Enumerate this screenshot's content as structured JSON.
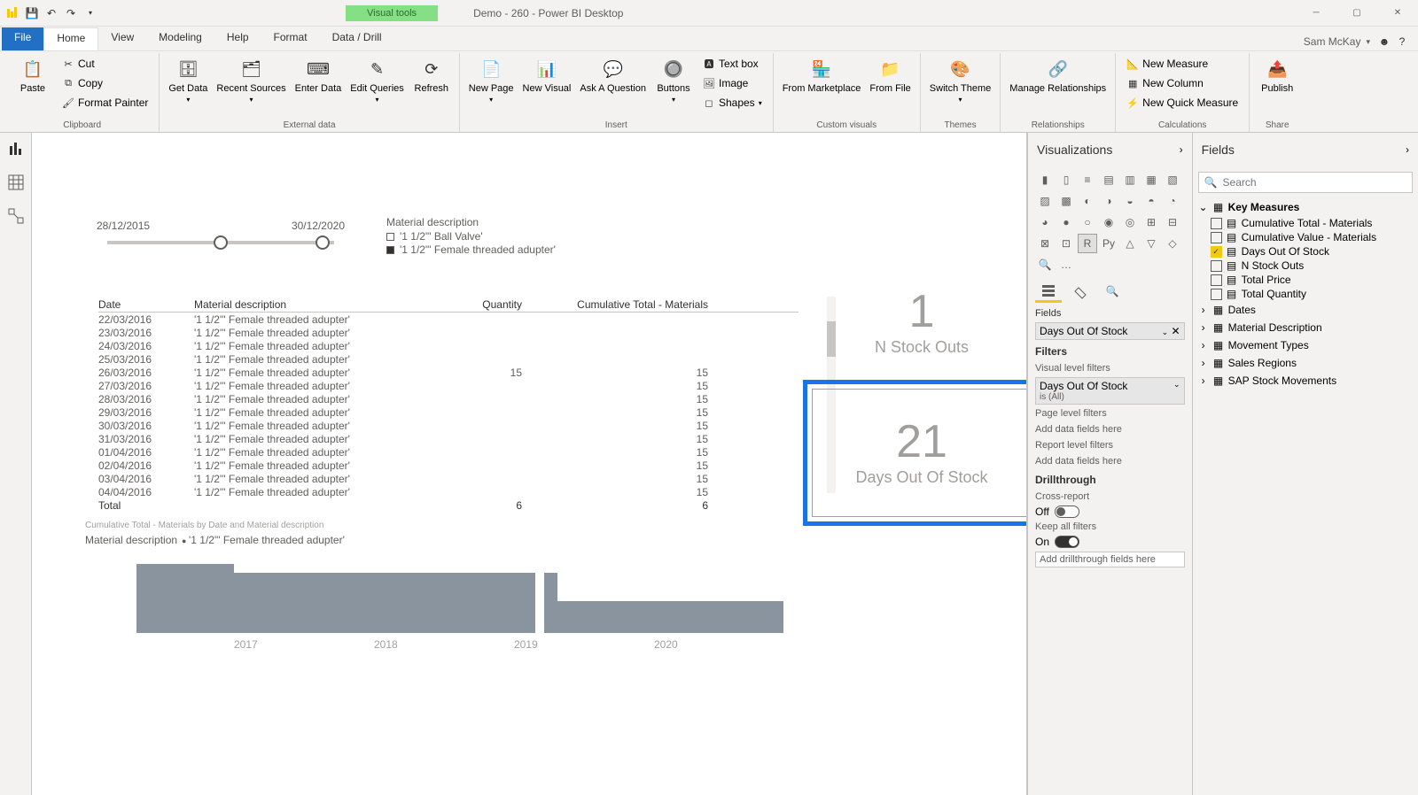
{
  "titlebar": {
    "visual_tools": "Visual tools",
    "doc": "Demo - 260 - Power BI Desktop"
  },
  "account": {
    "name": "Sam McKay"
  },
  "tabs": {
    "file": "File",
    "home": "Home",
    "view": "View",
    "modeling": "Modeling",
    "help": "Help",
    "format": "Format",
    "datadrill": "Data / Drill"
  },
  "ribbon": {
    "clipboard": {
      "label": "Clipboard",
      "paste": "Paste",
      "cut": "Cut",
      "copy": "Copy",
      "fmt": "Format Painter"
    },
    "external": {
      "label": "External data",
      "get": "Get Data",
      "recent": "Recent Sources",
      "enter": "Enter Data",
      "edit": "Edit Queries",
      "refresh": "Refresh"
    },
    "insert": {
      "label": "Insert",
      "newpage": "New Page",
      "newvis": "New Visual",
      "ask": "Ask A Question",
      "buttons": "Buttons",
      "textbox": "Text box",
      "image": "Image",
      "shapes": "Shapes"
    },
    "custom": {
      "label": "Custom visuals",
      "market": "From Marketplace",
      "file": "From File"
    },
    "themes": {
      "label": "Themes",
      "switch": "Switch Theme"
    },
    "rel": {
      "label": "Relationships",
      "manage": "Manage Relationships"
    },
    "calc": {
      "label": "Calculations",
      "nm": "New Measure",
      "nc": "New Column",
      "nq": "New Quick Measure"
    },
    "share": {
      "label": "Share",
      "publish": "Publish"
    }
  },
  "canvas": {
    "slicer": {
      "from": "28/12/2015",
      "to": "30/12/2020"
    },
    "legend": {
      "title": "Material description",
      "s1": "'1 1/2\"' Ball Valve'",
      "s2": "'1 1/2\"' Female threaded adupter'"
    },
    "table": {
      "headers": [
        "Date",
        "Material description",
        "Quantity",
        "Cumulative Total - Materials"
      ],
      "rows": [
        [
          "22/03/2016",
          "'1 1/2\"' Female threaded adupter'",
          "",
          ""
        ],
        [
          "23/03/2016",
          "'1 1/2\"' Female threaded adupter'",
          "",
          ""
        ],
        [
          "24/03/2016",
          "'1 1/2\"' Female threaded adupter'",
          "",
          ""
        ],
        [
          "25/03/2016",
          "'1 1/2\"' Female threaded adupter'",
          "",
          ""
        ],
        [
          "26/03/2016",
          "'1 1/2\"' Female threaded adupter'",
          "15",
          "15"
        ],
        [
          "27/03/2016",
          "'1 1/2\"' Female threaded adupter'",
          "",
          "15"
        ],
        [
          "28/03/2016",
          "'1 1/2\"' Female threaded adupter'",
          "",
          "15"
        ],
        [
          "29/03/2016",
          "'1 1/2\"' Female threaded adupter'",
          "",
          "15"
        ],
        [
          "30/03/2016",
          "'1 1/2\"' Female threaded adupter'",
          "",
          "15"
        ],
        [
          "31/03/2016",
          "'1 1/2\"' Female threaded adupter'",
          "",
          "15"
        ],
        [
          "01/04/2016",
          "'1 1/2\"' Female threaded adupter'",
          "",
          "15"
        ],
        [
          "02/04/2016",
          "'1 1/2\"' Female threaded adupter'",
          "",
          "15"
        ],
        [
          "03/04/2016",
          "'1 1/2\"' Female threaded adupter'",
          "",
          "15"
        ],
        [
          "04/04/2016",
          "'1 1/2\"' Female threaded adupter'",
          "",
          "15"
        ]
      ],
      "total": [
        "Total",
        "",
        "6",
        "6"
      ]
    },
    "card1": {
      "value": "1",
      "label": "N Stock Outs"
    },
    "card2": {
      "value": "21",
      "label": "Days Out Of Stock"
    },
    "chart": {
      "title": "Cumulative Total - Materials by Date and Material description",
      "legendlabel": "Material description",
      "series": "'1 1/2\"' Female threaded adupter'"
    }
  },
  "vis": {
    "title": "Visualizations",
    "fields": "Fields",
    "well_field": "Days Out Of Stock",
    "filters": "Filters",
    "vlf": "Visual level filters",
    "vlf_field": "Days Out Of Stock",
    "vlf_sub": "is (All)",
    "plf": "Page level filters",
    "plf_drop": "Add data fields here",
    "rlf": "Report level filters",
    "rlf_drop": "Add data fields here",
    "drill": "Drillthrough",
    "cross": "Cross-report",
    "off": "Off",
    "keep": "Keep all filters",
    "on": "On",
    "drill_drop": "Add drillthrough fields here"
  },
  "fields": {
    "title": "Fields",
    "search_ph": "Search",
    "t_key": "Key Measures",
    "m": [
      "Cumulative Total - Materials",
      "Cumulative Value - Materials",
      "Days Out Of Stock",
      "N Stock Outs",
      "Total Price",
      "Total Quantity"
    ],
    "tables": [
      "Dates",
      "Material Description",
      "Movement Types",
      "Sales Regions",
      "SAP Stock Movements"
    ]
  },
  "chart_data": {
    "type": "area",
    "title": "Cumulative Total - Materials by Date and Material description",
    "xlabel": "",
    "ylabel": "",
    "ylim": [
      0,
      15
    ],
    "series": [
      {
        "name": "'1 1/2\"' Female threaded adupter'",
        "x": [
          "2016.2",
          "2017",
          "2017.7",
          "2018",
          "2019",
          "2019.05",
          "2019.15",
          "2019.2",
          "2020",
          "2020.9"
        ],
        "y": [
          15,
          15,
          13,
          13,
          13,
          0,
          13,
          7,
          7,
          7
        ]
      }
    ],
    "xticks": [
      "2017",
      "2018",
      "2019",
      "2020"
    ]
  }
}
